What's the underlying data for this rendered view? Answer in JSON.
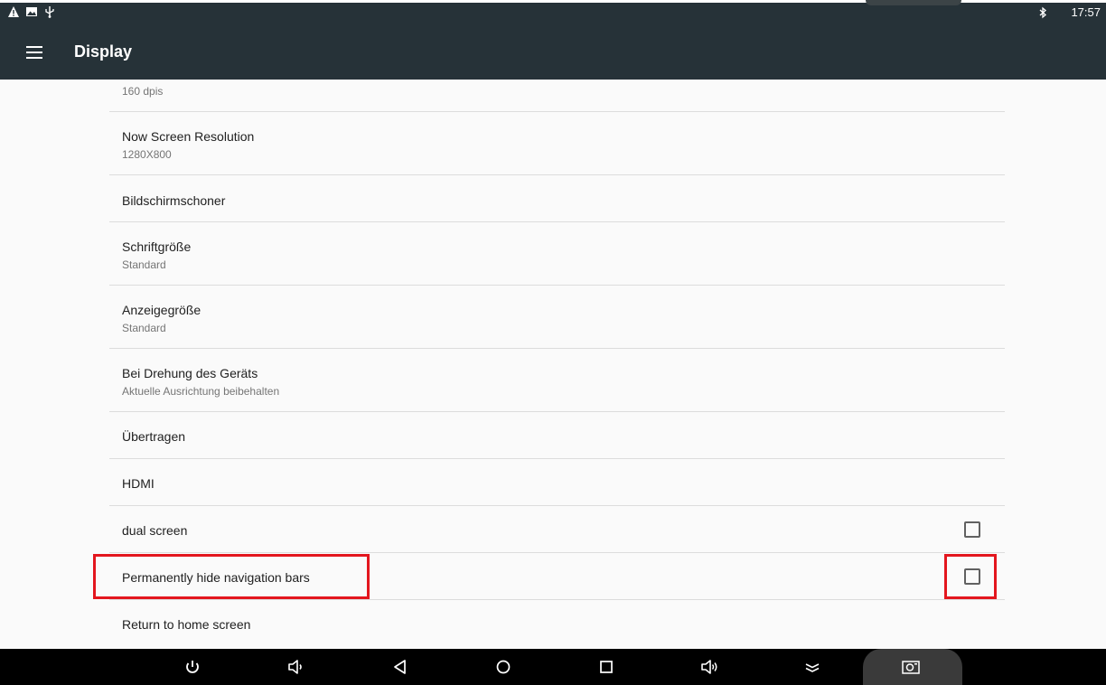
{
  "status_bar": {
    "time": "17:57",
    "left_icons": [
      "warning-icon",
      "image-icon",
      "usb-icon"
    ],
    "right_icons": [
      "bluetooth-icon"
    ]
  },
  "app_bar": {
    "title": "Display",
    "menu_icon": "hamburger-menu-icon"
  },
  "settings": {
    "items": [
      {
        "summary": "160 dpis"
      },
      {
        "title": "Now Screen Resolution",
        "summary": "1280X800"
      },
      {
        "title": "Bildschirmschoner"
      },
      {
        "title": "Schriftgröße",
        "summary": "Standard"
      },
      {
        "title": "Anzeigegröße",
        "summary": "Standard"
      },
      {
        "title": "Bei Drehung des Geräts",
        "summary": "Aktuelle Ausrichtung beibehalten"
      },
      {
        "title": "Übertragen"
      },
      {
        "title": "HDMI"
      },
      {
        "title": "dual screen",
        "checked": false
      },
      {
        "title": "Permanently hide navigation bars",
        "checked": false,
        "highlighted": true
      },
      {
        "title": "Return to home screen"
      }
    ]
  },
  "nav_bar": {
    "buttons": [
      "power-icon",
      "volume-down-icon",
      "back-icon",
      "home-icon",
      "recents-icon",
      "volume-up-icon",
      "collapse-icon",
      "screenshot-icon"
    ]
  },
  "colors": {
    "app_bar": "#263238",
    "background": "#fafafa",
    "highlight": "#e3161e",
    "divider": "#dcdcdc"
  }
}
